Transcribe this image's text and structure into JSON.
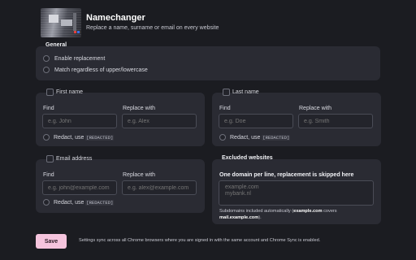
{
  "header": {
    "title": "Namechanger",
    "subtitle": "Replace a name, surname or email on every website"
  },
  "general": {
    "heading": "General",
    "options": [
      {
        "label": "Enable replacement",
        "checked": false
      },
      {
        "label": "Match regardless of upper/lowercase",
        "checked": false
      }
    ]
  },
  "first_name": {
    "title": "First name",
    "find_label": "Find",
    "replace_label": "Replace with",
    "find_placeholder": "e.g. John",
    "replace_placeholder": "e.g. Alex",
    "redact_label": "Redact, use",
    "redact_token": "[REDACTED]"
  },
  "last_name": {
    "title": "Last name",
    "find_label": "Find",
    "replace_label": "Replace with",
    "find_placeholder": "e.g. Doe",
    "replace_placeholder": "e.g. Smith",
    "redact_label": "Redact, use",
    "redact_token": "[REDACTED]"
  },
  "email": {
    "title": "Email address",
    "find_label": "Find",
    "replace_label": "Replace with",
    "find_placeholder": "e.g. john@example.com",
    "replace_placeholder": "e.g. alex@example.com",
    "redact_label": "Redact, use",
    "redact_token": "[REDACTED]"
  },
  "excluded": {
    "title": "Excluded websites",
    "instruction": "One domain per line, replacement is skipped here",
    "placeholder": "example.com\nmybank.nl",
    "hint_prefix": "Subdomains included automatically (",
    "hint_domain": "example.com",
    "hint_mid": " covers ",
    "hint_sub": "mail.example.com",
    "hint_suffix": ")."
  },
  "footer": {
    "save_label": "Save",
    "note": "Settings sync across all Chrome browsers where you are signed in with the same account and Chrome Sync is enabled."
  },
  "colors": {
    "background": "#1b1c21",
    "panel": "#2a2b33",
    "accent": "#f5c4dd"
  }
}
